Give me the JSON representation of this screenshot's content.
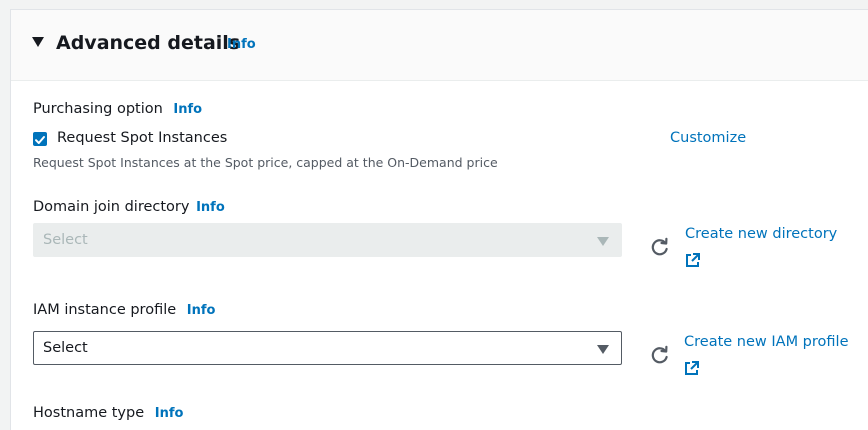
{
  "section": {
    "title": "Advanced details",
    "info": "Info"
  },
  "purchasing": {
    "label": "Purchasing option",
    "info": "Info",
    "checkbox_label": "Request Spot Instances",
    "checked": true,
    "customize": "Customize",
    "description": "Request Spot Instances at the Spot price, capped at the On-Demand price"
  },
  "domain": {
    "label": "Domain join directory",
    "info": "Info",
    "placeholder": "Select",
    "create_link": "Create new directory"
  },
  "iam": {
    "label": "IAM instance profile",
    "info": "Info",
    "value": "Select",
    "create_link": "Create new IAM profile"
  },
  "hostname": {
    "label": "Hostname type",
    "info": "Info"
  },
  "colors": {
    "link": "#0073bb",
    "text": "#16191f",
    "secondary_text": "#545b64",
    "disabled_bg": "#eaeded",
    "header_bg": "#fafafa",
    "page_bg": "#f2f3f3"
  },
  "icons": {
    "expand": "caret-down-icon",
    "checkbox": "checkmark-icon",
    "refresh": "refresh-icon",
    "external": "external-link-icon"
  }
}
